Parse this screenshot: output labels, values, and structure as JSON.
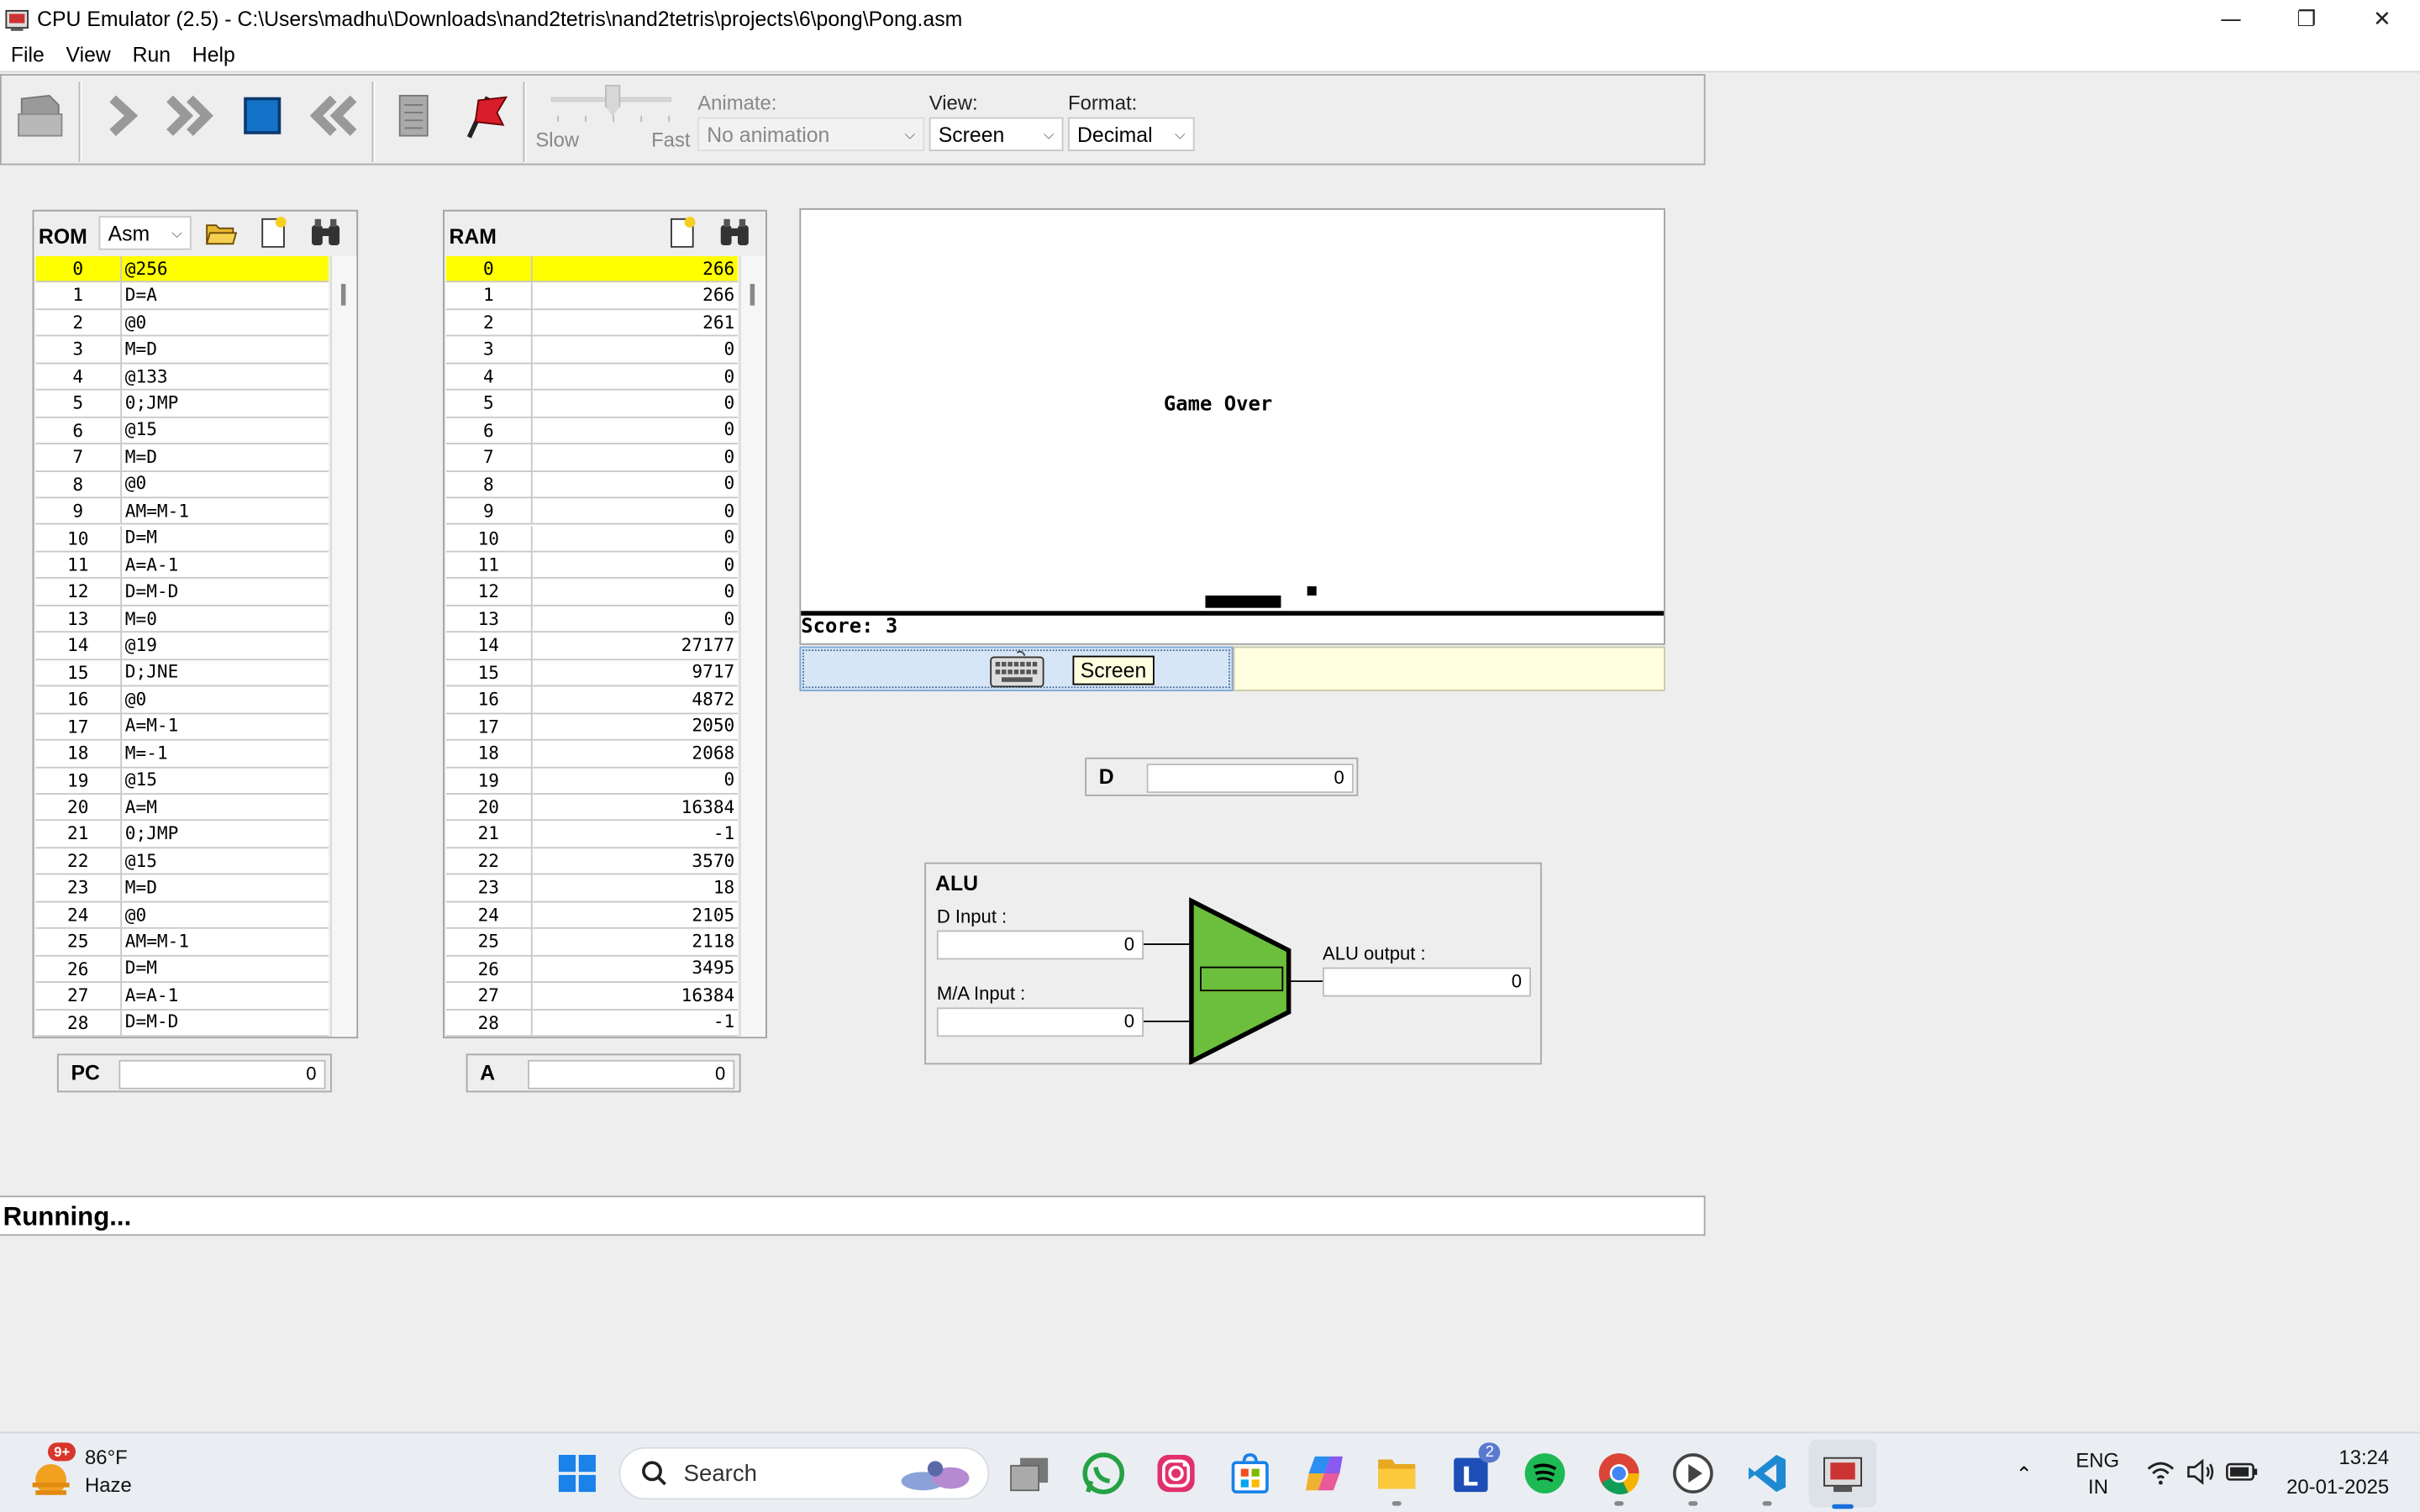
{
  "window": {
    "title": "CPU Emulator (2.5) - C:\\Users\\madhu\\Downloads\\nand2tetris\\nand2tetris\\projects\\6\\pong\\Pong.asm"
  },
  "menu": [
    "File",
    "View",
    "Run",
    "Help"
  ],
  "toolbar": {
    "slider_slow": "Slow",
    "slider_fast": "Fast",
    "animate_label": "Animate:",
    "animate_value": "No animation",
    "view_label": "View:",
    "view_value": "Screen",
    "format_label": "Format:",
    "format_value": "Decimal"
  },
  "rom": {
    "title": "ROM",
    "mode": "Asm",
    "rows": [
      {
        "addr": "0",
        "code": "@256"
      },
      {
        "addr": "1",
        "code": "D=A"
      },
      {
        "addr": "2",
        "code": "@0"
      },
      {
        "addr": "3",
        "code": "M=D"
      },
      {
        "addr": "4",
        "code": "@133"
      },
      {
        "addr": "5",
        "code": "0;JMP"
      },
      {
        "addr": "6",
        "code": "@15"
      },
      {
        "addr": "7",
        "code": "M=D"
      },
      {
        "addr": "8",
        "code": "@0"
      },
      {
        "addr": "9",
        "code": "AM=M-1"
      },
      {
        "addr": "10",
        "code": "D=M"
      },
      {
        "addr": "11",
        "code": "A=A-1"
      },
      {
        "addr": "12",
        "code": "D=M-D"
      },
      {
        "addr": "13",
        "code": "M=0"
      },
      {
        "addr": "14",
        "code": "@19"
      },
      {
        "addr": "15",
        "code": "D;JNE"
      },
      {
        "addr": "16",
        "code": "@0"
      },
      {
        "addr": "17",
        "code": "A=M-1"
      },
      {
        "addr": "18",
        "code": "M=-1"
      },
      {
        "addr": "19",
        "code": "@15"
      },
      {
        "addr": "20",
        "code": "A=M"
      },
      {
        "addr": "21",
        "code": "0;JMP"
      },
      {
        "addr": "22",
        "code": "@15"
      },
      {
        "addr": "23",
        "code": "M=D"
      },
      {
        "addr": "24",
        "code": "@0"
      },
      {
        "addr": "25",
        "code": "AM=M-1"
      },
      {
        "addr": "26",
        "code": "D=M"
      },
      {
        "addr": "27",
        "code": "A=A-1"
      },
      {
        "addr": "28",
        "code": "D=M-D"
      }
    ]
  },
  "ram": {
    "title": "RAM",
    "rows": [
      {
        "addr": "0",
        "value": "266"
      },
      {
        "addr": "1",
        "value": "266"
      },
      {
        "addr": "2",
        "value": "261"
      },
      {
        "addr": "3",
        "value": "0"
      },
      {
        "addr": "4",
        "value": "0"
      },
      {
        "addr": "5",
        "value": "0"
      },
      {
        "addr": "6",
        "value": "0"
      },
      {
        "addr": "7",
        "value": "0"
      },
      {
        "addr": "8",
        "value": "0"
      },
      {
        "addr": "9",
        "value": "0"
      },
      {
        "addr": "10",
        "value": "0"
      },
      {
        "addr": "11",
        "value": "0"
      },
      {
        "addr": "12",
        "value": "0"
      },
      {
        "addr": "13",
        "value": "0"
      },
      {
        "addr": "14",
        "value": "27177"
      },
      {
        "addr": "15",
        "value": "9717"
      },
      {
        "addr": "16",
        "value": "4872"
      },
      {
        "addr": "17",
        "value": "2050"
      },
      {
        "addr": "18",
        "value": "2068"
      },
      {
        "addr": "19",
        "value": "0"
      },
      {
        "addr": "20",
        "value": "16384"
      },
      {
        "addr": "21",
        "value": "-1"
      },
      {
        "addr": "22",
        "value": "3570"
      },
      {
        "addr": "23",
        "value": "18"
      },
      {
        "addr": "24",
        "value": "2105"
      },
      {
        "addr": "25",
        "value": "2118"
      },
      {
        "addr": "26",
        "value": "3495"
      },
      {
        "addr": "27",
        "value": "16384"
      },
      {
        "addr": "28",
        "value": "-1"
      }
    ]
  },
  "registers": {
    "pc_label": "PC",
    "pc_value": "0",
    "a_label": "A",
    "a_value": "0",
    "d_label": "D",
    "d_value": "0"
  },
  "screen": {
    "game_over": "Game Over",
    "score": "Score: 3",
    "tag": "Screen"
  },
  "alu": {
    "title": "ALU",
    "d_input_label": "D Input :",
    "d_input_value": "0",
    "ma_input_label": "M/A Input :",
    "ma_input_value": "0",
    "output_label": "ALU output :",
    "output_value": "0",
    "body_color": "#6cbf3c"
  },
  "status": {
    "text": "Running..."
  },
  "taskbar": {
    "weather_temp": "86°F",
    "weather_cond": "Haze",
    "weather_badge": "9+",
    "search_label": "Search",
    "l_badge": "2",
    "lang_top": "ENG",
    "lang_bottom": "IN",
    "time": "13:24",
    "date": "20-01-2025"
  }
}
